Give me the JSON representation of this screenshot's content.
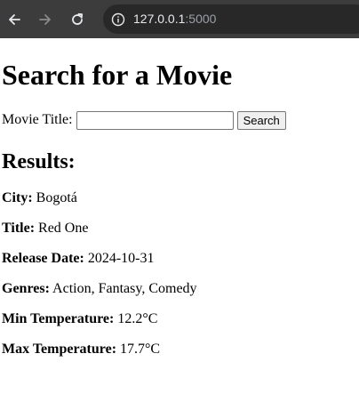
{
  "browser": {
    "url_host": "127.0.0.1",
    "url_port": ":5000"
  },
  "page": {
    "title": "Search for a Movie",
    "search_label": "Movie Title:",
    "search_value": "",
    "search_button": "Search",
    "results_heading": "Results:",
    "results": [
      {
        "label": "City:",
        "value": "Bogotá"
      },
      {
        "label": "Title:",
        "value": "Red One"
      },
      {
        "label": "Release Date:",
        "value": "2024-10-31"
      },
      {
        "label": "Genres:",
        "value": "Action, Fantasy, Comedy"
      },
      {
        "label": "Min Temperature:",
        "value": "12.2°C"
      },
      {
        "label": "Max Temperature:",
        "value": "17.7°C"
      }
    ]
  },
  "colors": {
    "toolbar_bg": "#3c3c3c",
    "omnibox_bg": "#282828",
    "url_host": "#e8eaed",
    "url_port": "#9aa0a6"
  }
}
